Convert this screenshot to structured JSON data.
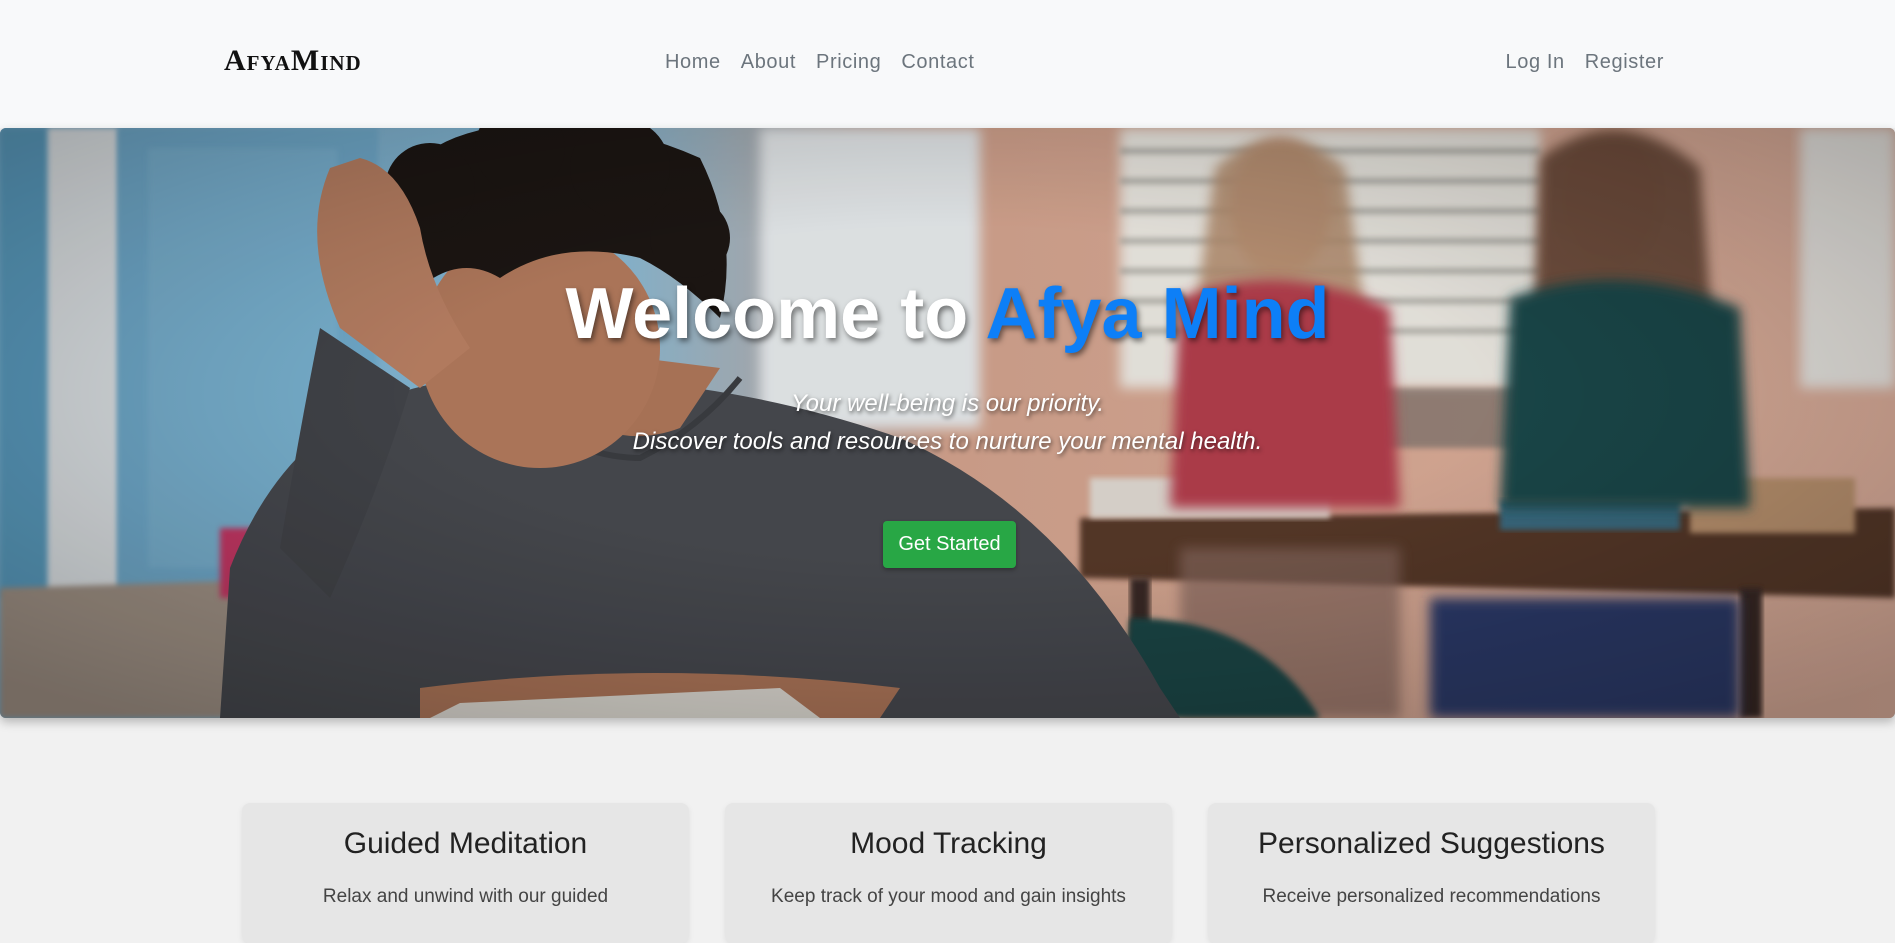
{
  "brand": "AfyaMind",
  "nav": {
    "main": [
      "Home",
      "About",
      "Pricing",
      "Contact"
    ],
    "auth": [
      "Log In",
      "Register"
    ]
  },
  "hero": {
    "title_prefix": "Welcome to ",
    "title_accent": "Afya Mind",
    "subtitle_line1": "Your well-being is our priority.",
    "subtitle_line2": "Discover tools and resources to nurture your mental health.",
    "cta_label": "Get Started"
  },
  "features": [
    {
      "title": "Guided Meditation",
      "text": "Relax and unwind with our guided"
    },
    {
      "title": "Mood Tracking",
      "text": "Keep track of your mood and gain insights"
    },
    {
      "title": "Personalized Suggestions",
      "text": "Receive personalized recommendations"
    }
  ],
  "colors": {
    "accent": "#0d7ff7",
    "cta": "#28a745",
    "navbar_bg": "#f8f9fa",
    "nav_link": "#6c757d"
  }
}
